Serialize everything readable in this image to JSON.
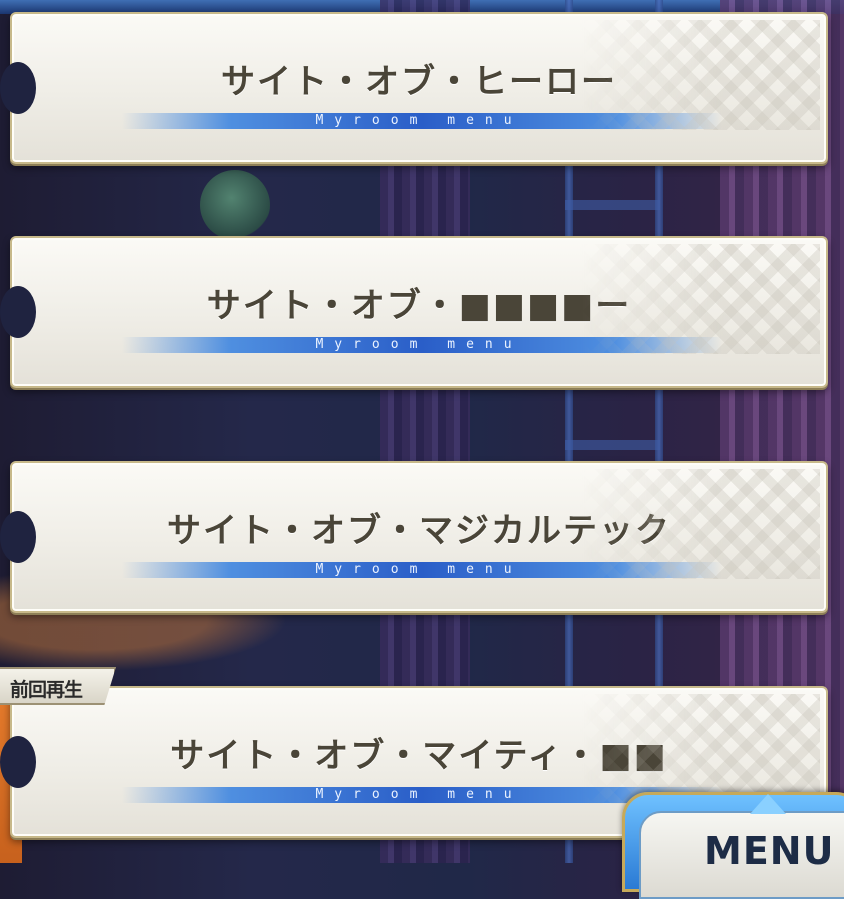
{
  "entries": [
    {
      "title": "サイト・オブ・ヒーロー",
      "subtitle": "Myroom menu"
    },
    {
      "title": "サイト・オブ・■■■■ー",
      "subtitle": "Myroom menu"
    },
    {
      "title": "サイト・オブ・マジカルテック",
      "subtitle": "Myroom menu"
    },
    {
      "title": "サイト・オブ・マイティ・■■",
      "subtitle": "Myroom menu"
    }
  ],
  "last_played_tag": "前回再生",
  "menu_button": {
    "label": "MENU"
  },
  "colors": {
    "card_bg": "#f3f1ea",
    "card_border": "#c7b98a",
    "title_text": "#4a4538",
    "band_blue": "#2a5ec8",
    "menu_blue": "#3c8fe0"
  },
  "icons": {
    "menu_arrow": "triangle-up-icon"
  }
}
